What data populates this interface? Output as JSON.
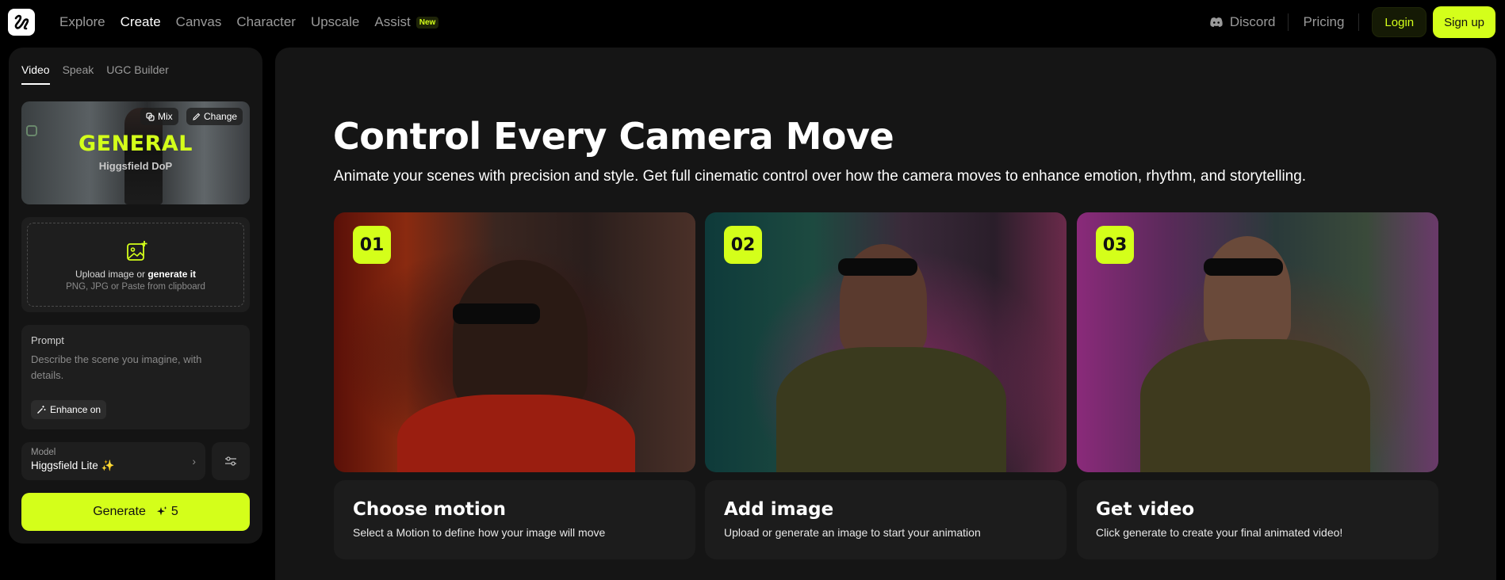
{
  "nav": {
    "links": [
      "Explore",
      "Create",
      "Canvas",
      "Character",
      "Upscale",
      "Assist"
    ],
    "active_link": "Create",
    "assist_badge": "New",
    "discord": "Discord",
    "pricing": "Pricing",
    "login": "Login",
    "signup": "Sign up"
  },
  "sidebar": {
    "tabs": [
      "Video",
      "Speak",
      "UGC Builder"
    ],
    "active_tab": "Video",
    "preset": {
      "title": "GENERAL",
      "subtitle": "Higgsfield DoP",
      "mix_label": "Mix",
      "change_label": "Change"
    },
    "upload": {
      "text_prefix": "Upload image or ",
      "text_link": "generate it",
      "subtext": "PNG, JPG or Paste from clipboard"
    },
    "prompt": {
      "label": "Prompt",
      "placeholder": "Describe the scene you imagine, with details.",
      "enhance_label": "Enhance on"
    },
    "model": {
      "label": "Model",
      "value": "Higgsfield Lite ✨"
    },
    "generate": {
      "label": "Generate",
      "cost": "5"
    }
  },
  "main": {
    "title": "Control Every Camera Move",
    "subtitle": "Animate your scenes with precision and style. Get full cinematic control over how the camera moves to enhance emotion, rhythm, and storytelling.",
    "steps": [
      {
        "number": "01",
        "title": "Choose motion",
        "desc": "Select a Motion to define how your image will move"
      },
      {
        "number": "02",
        "title": "Add image",
        "desc": "Upload or generate an image to start your animation"
      },
      {
        "number": "03",
        "title": "Get video",
        "desc": "Click generate to create your final animated video!"
      }
    ]
  },
  "colors": {
    "accent": "#d4ff1a",
    "background": "#000000",
    "panel": "#141414",
    "card": "#1c1c1c"
  }
}
